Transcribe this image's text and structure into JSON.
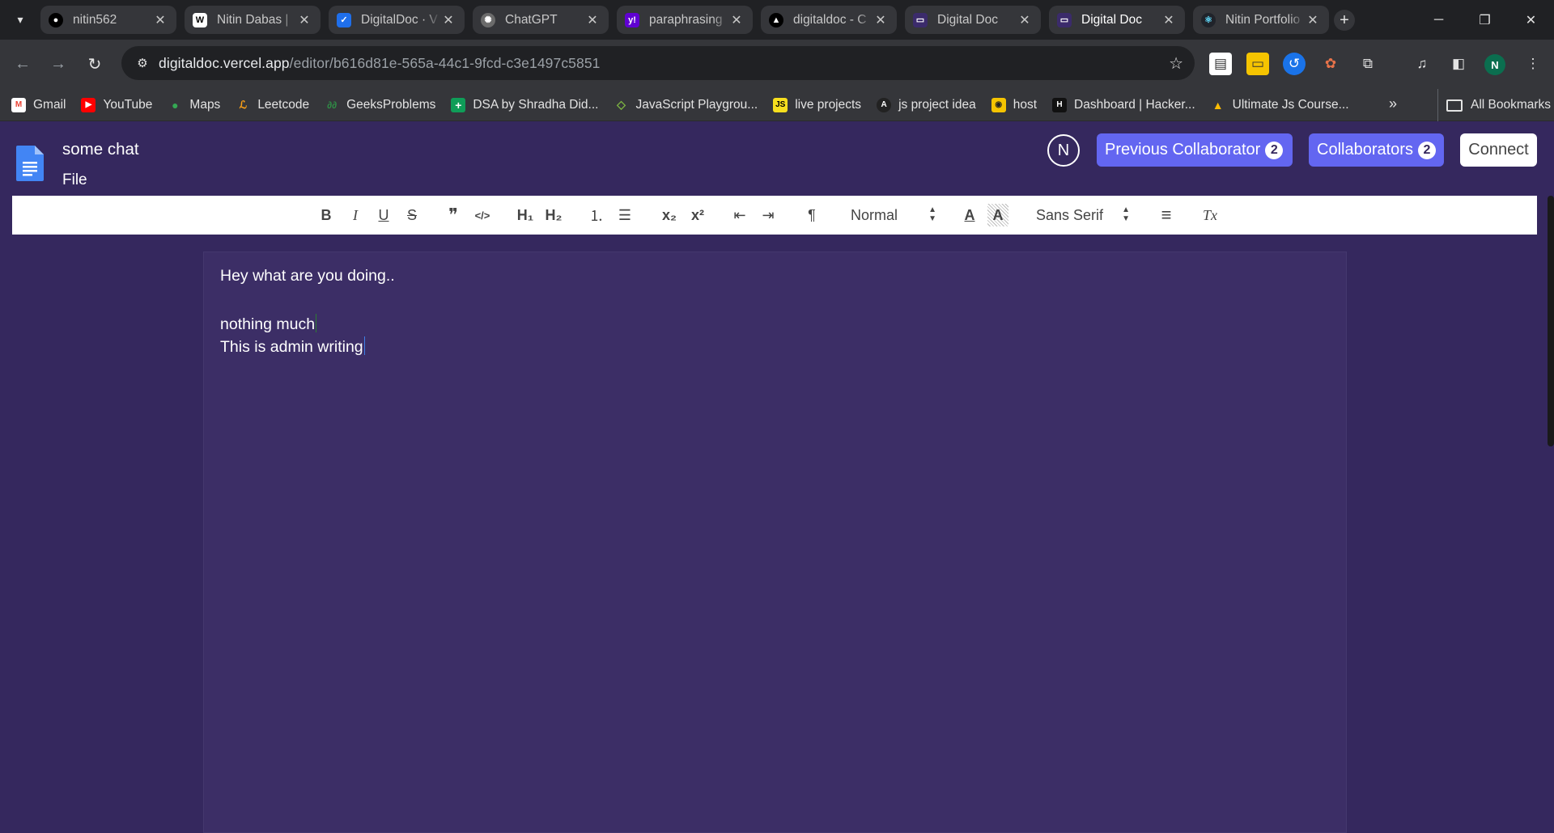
{
  "browser": {
    "tabs": [
      {
        "title": "nitin562",
        "icon": "github-icon",
        "close": "✕"
      },
      {
        "title": "Nitin Dabas |",
        "icon": "wellfound-icon",
        "close": "✕"
      },
      {
        "title": "DigitalDoc · V",
        "icon": "vercel-check-icon",
        "close": "✕"
      },
      {
        "title": "ChatGPT",
        "icon": "chatgpt-icon",
        "close": "✕"
      },
      {
        "title": "paraphrasing",
        "icon": "yahoo-icon",
        "close": "✕"
      },
      {
        "title": "digitaldoc - C",
        "icon": "vercel-icon",
        "close": "✕"
      },
      {
        "title": "Digital Doc",
        "icon": "digitaldoc-icon",
        "close": "✕"
      },
      {
        "title": "Digital Doc",
        "icon": "digitaldoc-icon",
        "close": "✕",
        "active": true
      },
      {
        "title": "Nitin Portfolio",
        "icon": "react-icon",
        "close": "✕"
      }
    ],
    "new_tab": "+",
    "window_controls": {
      "minimize": "─",
      "restore": "❐",
      "close": "✕"
    },
    "url_host": "digitaldoc.vercel.app",
    "url_path": "/editor/b616d81e-565a-44c1-9fcd-c3e1497c5851",
    "profile_initial": "N",
    "bookmarks": [
      {
        "label": "Gmail",
        "icon": "gmail-icon",
        "color": "#ea4335",
        "glyph": "M"
      },
      {
        "label": "YouTube",
        "icon": "youtube-icon",
        "color": "#ff0000",
        "glyph": "▶"
      },
      {
        "label": "Maps",
        "icon": "maps-icon",
        "color": "#34a853",
        "glyph": "●"
      },
      {
        "label": "Leetcode",
        "icon": "leetcode-icon",
        "color": "#3a3a3a",
        "glyph": "L"
      },
      {
        "label": "GeeksProblems",
        "icon": "geeksforgeeks-icon",
        "color": "#2f8d46",
        "glyph": "G"
      },
      {
        "label": "DSA by Shradha Did...",
        "icon": "sheets-icon",
        "color": "#0f9d58",
        "glyph": "+"
      },
      {
        "label": "JavaScript Playgrou...",
        "icon": "playground-icon",
        "color": "#3a3a3a",
        "glyph": "◇"
      },
      {
        "label": "live projects",
        "icon": "js-icon",
        "color": "#f7df1e",
        "glyph": "JS"
      },
      {
        "label": "js project idea",
        "icon": "js-idea-icon",
        "color": "#222222",
        "glyph": "A"
      },
      {
        "label": "host",
        "icon": "host-icon",
        "color": "#f5c400",
        "glyph": "◉"
      },
      {
        "label": "Dashboard | Hacker...",
        "icon": "hackerrank-icon",
        "color": "#111111",
        "glyph": "H"
      },
      {
        "label": "Ultimate Js Course...",
        "icon": "drive-icon",
        "color": "#fbbc04",
        "glyph": "▲"
      }
    ],
    "bookmarks_more": "»",
    "all_bookmarks": "All Bookmarks"
  },
  "app": {
    "doc_title": "some chat",
    "file_menu": "File",
    "user_initial": "N",
    "previous_collaborator_label": "Previous Collaborator",
    "previous_collaborator_count": "2",
    "collaborators_label": "Collaborators",
    "collaborators_count": "2",
    "connect_label": "Connect",
    "accent_color": "#6366f1",
    "background_color": "#35285e"
  },
  "toolbar": {
    "bold": "B",
    "italic": "I",
    "underline": "U",
    "strike": "S",
    "blockquote": "❞",
    "code": "</>",
    "h1": "H₁",
    "h2": "H₂",
    "ordered_list": "⒈",
    "bullet_list": "☰",
    "subscript": "x₂",
    "superscript": "x²",
    "outdent": "⇤",
    "indent": "⇥",
    "direction": "¶",
    "header_select": "Normal",
    "text_color": "A",
    "background_color": "A",
    "font_select": "Sans Serif",
    "align": "≡",
    "clean": "Tx"
  },
  "editor": {
    "lines": [
      "Hey what are you doing..",
      "nothing much",
      "This is admin writing"
    ],
    "caret_colors": [
      "#2e7d32",
      "#3f7fe6"
    ]
  }
}
